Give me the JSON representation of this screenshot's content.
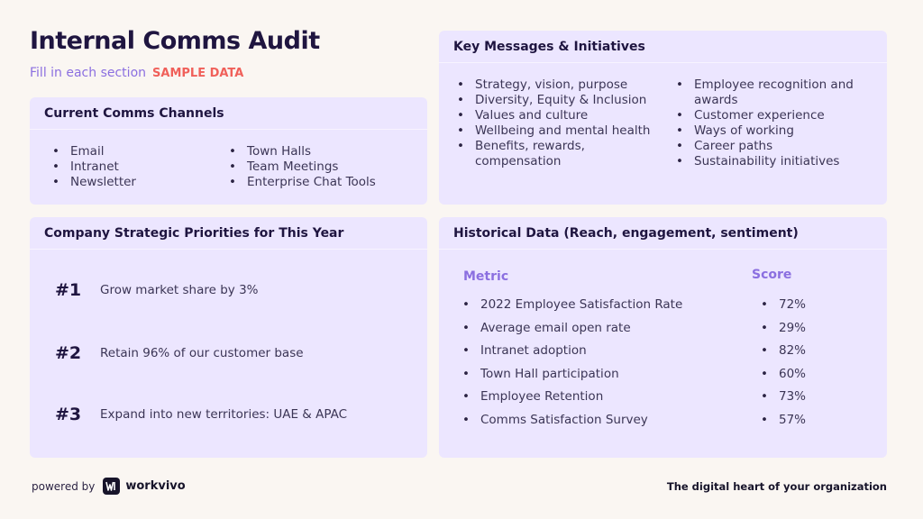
{
  "header": {
    "title": "Internal Comms Audit",
    "subtitle": "Fill in each section",
    "tag": "SAMPLE DATA"
  },
  "channels": {
    "title": "Current Comms Channels",
    "col1": [
      "Email",
      "Intranet",
      "Newsletter"
    ],
    "col2": [
      "Town Halls",
      "Team Meetings",
      "Enterprise Chat Tools"
    ]
  },
  "messages": {
    "title": "Key Messages & Initiatives",
    "col1": [
      "Strategy, vision, purpose",
      "Diversity, Equity & Inclusion",
      "Values and culture",
      "Wellbeing and mental health",
      "Benefits, rewards, compensation"
    ],
    "col2": [
      "Employee recognition and awards",
      "Customer experience",
      "Ways of working",
      "Career paths",
      "Sustainability initiatives"
    ]
  },
  "priorities": {
    "title": "Company Strategic Priorities for This Year",
    "items": [
      {
        "num": "#1",
        "text": "Grow market share by 3%"
      },
      {
        "num": "#2",
        "text": "Retain 96% of our customer base"
      },
      {
        "num": "#3",
        "text": "Expand into new territories: UAE & APAC"
      }
    ]
  },
  "history": {
    "title": "Historical Data (Reach, engagement, sentiment)",
    "metric_header": "Metric",
    "score_header": "Score",
    "metrics": [
      "2022 Employee Satisfaction Rate",
      "Average email open rate",
      "Intranet adoption",
      "Town Hall participation",
      "Employee Retention",
      "Comms Satisfaction Survey"
    ],
    "scores": [
      "72%",
      "29%",
      "82%",
      "60%",
      "73%",
      "57%"
    ]
  },
  "footer": {
    "powered_by": "powered by",
    "brand": "workvivo",
    "brand_icon": "workvivo-logo-icon",
    "tagline": "The digital heart of your organization"
  },
  "colors": {
    "card_bg": "#ece6ff",
    "accent_purple": "#8b6fe0",
    "accent_red": "#f0605a",
    "page_bg": "#faf6f2"
  }
}
